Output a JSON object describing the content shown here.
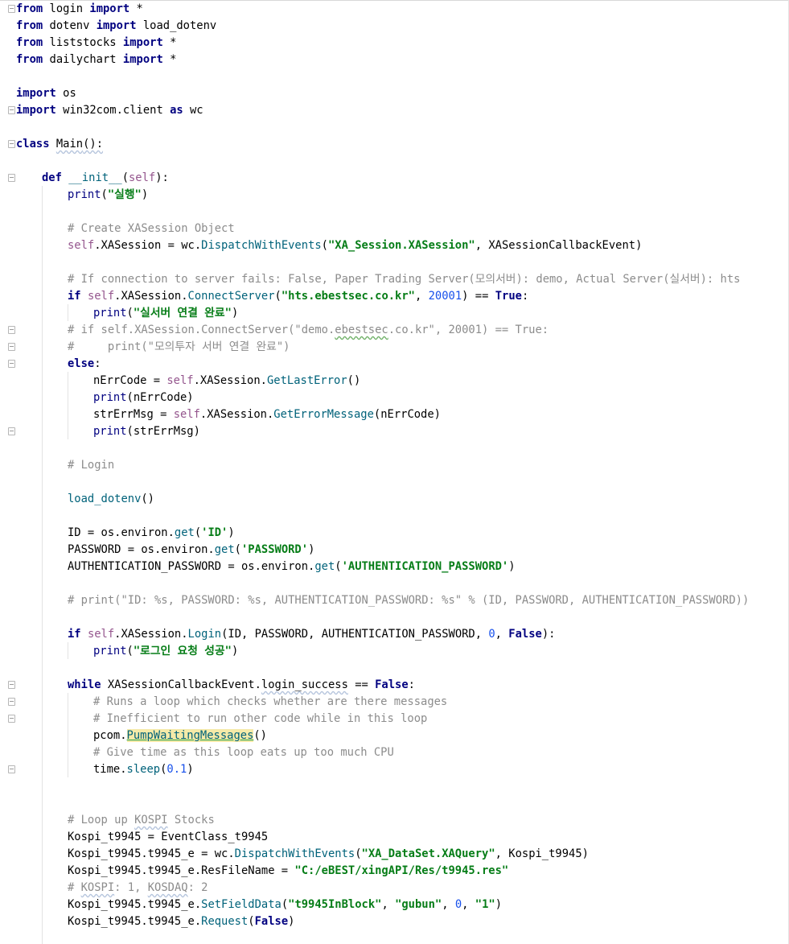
{
  "editor": {
    "lines": [
      {
        "row": 0,
        "indent": 0,
        "tokens": [
          {
            "t": "from",
            "c": "kw"
          },
          {
            "t": " login "
          },
          {
            "t": "import",
            "c": "kw"
          },
          {
            "t": " *"
          }
        ]
      },
      {
        "row": 1,
        "indent": 0,
        "tokens": [
          {
            "t": "from",
            "c": "kw"
          },
          {
            "t": " dotenv "
          },
          {
            "t": "import",
            "c": "kw"
          },
          {
            "t": " load_dotenv"
          }
        ]
      },
      {
        "row": 2,
        "indent": 0,
        "tokens": [
          {
            "t": "from",
            "c": "kw"
          },
          {
            "t": " liststocks "
          },
          {
            "t": "import",
            "c": "kw"
          },
          {
            "t": " *"
          }
        ]
      },
      {
        "row": 3,
        "indent": 0,
        "tokens": [
          {
            "t": "from",
            "c": "kw"
          },
          {
            "t": " dailychart "
          },
          {
            "t": "import",
            "c": "kw"
          },
          {
            "t": " *"
          }
        ]
      },
      {
        "row": 5,
        "indent": 0,
        "tokens": [
          {
            "t": "import",
            "c": "kw"
          },
          {
            "t": " os"
          }
        ]
      },
      {
        "row": 6,
        "indent": 0,
        "tokens": [
          {
            "t": "import",
            "c": "kw"
          },
          {
            "t": " win32com.client "
          },
          {
            "t": "as",
            "c": "kw"
          },
          {
            "t": " wc"
          }
        ]
      },
      {
        "row": 8,
        "indent": 0,
        "tokens": [
          {
            "t": "class",
            "c": "kw"
          },
          {
            "t": " "
          },
          {
            "t": "Main",
            "c": "ul"
          },
          {
            "t": "():",
            "c": "ul"
          }
        ]
      },
      {
        "row": 10,
        "indent": 1,
        "tokens": [
          {
            "t": "def",
            "c": "kw"
          },
          {
            "t": " "
          },
          {
            "t": "__init__",
            "c": "fn"
          },
          {
            "t": "("
          },
          {
            "t": "self",
            "c": "self"
          },
          {
            "t": "):"
          }
        ]
      },
      {
        "row": 11,
        "indent": 2,
        "tokens": [
          {
            "t": "print",
            "c": "builtin"
          },
          {
            "t": "("
          },
          {
            "t": "\"실행\"",
            "c": "str"
          },
          {
            "t": ")"
          }
        ]
      },
      {
        "row": 13,
        "indent": 2,
        "tokens": [
          {
            "t": "# Create XASession Object",
            "c": "cmt"
          }
        ]
      },
      {
        "row": 14,
        "indent": 2,
        "tokens": [
          {
            "t": "self",
            "c": "self"
          },
          {
            "t": ".XASession = wc."
          },
          {
            "t": "DispatchWithEvents",
            "c": "fn"
          },
          {
            "t": "("
          },
          {
            "t": "\"XA_Session.XASession\"",
            "c": "str"
          },
          {
            "t": ", XASessionCallbackEvent)"
          }
        ]
      },
      {
        "row": 16,
        "indent": 2,
        "tokens": [
          {
            "t": "# If connection to server fails: False, Paper Trading Server(모의서버): demo, Actual Server(실서버): hts",
            "c": "cmt"
          }
        ]
      },
      {
        "row": 17,
        "indent": 2,
        "tokens": [
          {
            "t": "if",
            "c": "kw"
          },
          {
            "t": " "
          },
          {
            "t": "self",
            "c": "self"
          },
          {
            "t": ".XASession."
          },
          {
            "t": "ConnectServer",
            "c": "fn"
          },
          {
            "t": "("
          },
          {
            "t": "\"hts.ebestsec.co.kr\"",
            "c": "str"
          },
          {
            "t": ", "
          },
          {
            "t": "20001",
            "c": "num"
          },
          {
            "t": ") == "
          },
          {
            "t": "True",
            "c": "kw"
          },
          {
            "t": ":"
          }
        ]
      },
      {
        "row": 18,
        "indent": 3,
        "tokens": [
          {
            "t": "print",
            "c": "builtin"
          },
          {
            "t": "("
          },
          {
            "t": "\"실서버 연결 완료\"",
            "c": "str"
          },
          {
            "t": ")"
          }
        ]
      },
      {
        "row": 19,
        "indent": 2,
        "tokens": [
          {
            "t": "# if self.XASession.ConnectServer(\"demo.",
            "c": "cmt"
          },
          {
            "t": "ebestsec",
            "c": "cmt green-ul"
          },
          {
            "t": ".co.kr\", 20001) == True:",
            "c": "cmt"
          }
        ]
      },
      {
        "row": 20,
        "indent": 2,
        "tokens": [
          {
            "t": "#     print(\"모의투자 서버 연결 완료\")",
            "c": "cmt"
          }
        ]
      },
      {
        "row": 21,
        "indent": 2,
        "tokens": [
          {
            "t": "else",
            "c": "kw"
          },
          {
            "t": ":"
          }
        ]
      },
      {
        "row": 22,
        "indent": 3,
        "tokens": [
          {
            "t": "nErrCode = "
          },
          {
            "t": "self",
            "c": "self"
          },
          {
            "t": ".XASession."
          },
          {
            "t": "GetLastError",
            "c": "fn"
          },
          {
            "t": "()"
          }
        ]
      },
      {
        "row": 23,
        "indent": 3,
        "tokens": [
          {
            "t": "print",
            "c": "builtin"
          },
          {
            "t": "(nErrCode)"
          }
        ]
      },
      {
        "row": 24,
        "indent": 3,
        "tokens": [
          {
            "t": "strErrMsg = "
          },
          {
            "t": "self",
            "c": "self"
          },
          {
            "t": ".XASession."
          },
          {
            "t": "GetErrorMessage",
            "c": "fn"
          },
          {
            "t": "(nErrCode)"
          }
        ]
      },
      {
        "row": 25,
        "indent": 3,
        "tokens": [
          {
            "t": "print",
            "c": "builtin"
          },
          {
            "t": "(strErrMsg)"
          }
        ]
      },
      {
        "row": 27,
        "indent": 2,
        "tokens": [
          {
            "t": "# Login",
            "c": "cmt"
          }
        ]
      },
      {
        "row": 29,
        "indent": 2,
        "tokens": [
          {
            "t": "load_dotenv",
            "c": "fn"
          },
          {
            "t": "()"
          }
        ]
      },
      {
        "row": 31,
        "indent": 2,
        "tokens": [
          {
            "t": "ID = os.environ."
          },
          {
            "t": "get",
            "c": "fn"
          },
          {
            "t": "("
          },
          {
            "t": "'ID'",
            "c": "str"
          },
          {
            "t": ")"
          }
        ]
      },
      {
        "row": 32,
        "indent": 2,
        "tokens": [
          {
            "t": "PASSWORD = os.environ."
          },
          {
            "t": "get",
            "c": "fn"
          },
          {
            "t": "("
          },
          {
            "t": "'PASSWORD'",
            "c": "str"
          },
          {
            "t": ")"
          }
        ]
      },
      {
        "row": 33,
        "indent": 2,
        "tokens": [
          {
            "t": "AUTHENTICATION_PASSWORD = os.environ."
          },
          {
            "t": "get",
            "c": "fn"
          },
          {
            "t": "("
          },
          {
            "t": "'AUTHENTICATION_PASSWORD'",
            "c": "str"
          },
          {
            "t": ")"
          }
        ]
      },
      {
        "row": 35,
        "indent": 2,
        "tokens": [
          {
            "t": "# print(\"ID: %s, PASSWORD: %s, AUTHENTICATION_PASSWORD: %s\" % (ID, PASSWORD, AUTHENTICATION_PASSWORD))",
            "c": "cmt"
          }
        ]
      },
      {
        "row": 37,
        "indent": 2,
        "tokens": [
          {
            "t": "if",
            "c": "kw"
          },
          {
            "t": " "
          },
          {
            "t": "self",
            "c": "self"
          },
          {
            "t": ".XASession."
          },
          {
            "t": "Login",
            "c": "fn"
          },
          {
            "t": "(ID, PASSWORD, AUTHENTICATION_PASSWORD, "
          },
          {
            "t": "0",
            "c": "num"
          },
          {
            "t": ", "
          },
          {
            "t": "False",
            "c": "kw"
          },
          {
            "t": "):"
          }
        ]
      },
      {
        "row": 38,
        "indent": 3,
        "tokens": [
          {
            "t": "print",
            "c": "builtin"
          },
          {
            "t": "("
          },
          {
            "t": "\"로그인 요청 성공\"",
            "c": "str"
          },
          {
            "t": ")"
          }
        ]
      },
      {
        "row": 40,
        "indent": 2,
        "tokens": [
          {
            "t": "while",
            "c": "kw"
          },
          {
            "t": " XASessionCallbackEvent."
          },
          {
            "t": "login_success",
            "c": "ul"
          },
          {
            "t": " == "
          },
          {
            "t": "False",
            "c": "kw"
          },
          {
            "t": ":"
          }
        ]
      },
      {
        "row": 41,
        "indent": 3,
        "tokens": [
          {
            "t": "# Runs a loop which checks whether are there messages",
            "c": "cmt"
          }
        ]
      },
      {
        "row": 42,
        "indent": 3,
        "tokens": [
          {
            "t": "# Inefficient to run other code while in this loop",
            "c": "cmt"
          }
        ]
      },
      {
        "row": 43,
        "indent": 3,
        "tokens": [
          {
            "t": "pcom."
          },
          {
            "t": "PumpWaitingMessages",
            "c": "fn hl"
          },
          {
            "t": "()"
          }
        ]
      },
      {
        "row": 44,
        "indent": 3,
        "tokens": [
          {
            "t": "# Give time as this loop eats up too much CPU",
            "c": "cmt"
          }
        ]
      },
      {
        "row": 45,
        "indent": 3,
        "tokens": [
          {
            "t": "time."
          },
          {
            "t": "sleep",
            "c": "fn"
          },
          {
            "t": "("
          },
          {
            "t": "0.1",
            "c": "num"
          },
          {
            "t": ")"
          }
        ]
      },
      {
        "row": 48,
        "indent": 2,
        "tokens": [
          {
            "t": "# Loop up ",
            "c": "cmt"
          },
          {
            "t": "KOSPI",
            "c": "cmt ul"
          },
          {
            "t": " Stocks",
            "c": "cmt"
          }
        ]
      },
      {
        "row": 49,
        "indent": 2,
        "tokens": [
          {
            "t": "Kospi_t9945 = EventClass_t9945"
          }
        ]
      },
      {
        "row": 50,
        "indent": 2,
        "tokens": [
          {
            "t": "Kospi_t9945.t9945_e = wc."
          },
          {
            "t": "DispatchWithEvents",
            "c": "fn"
          },
          {
            "t": "("
          },
          {
            "t": "\"XA_DataSet.XAQuery\"",
            "c": "str"
          },
          {
            "t": ", Kospi_t9945)"
          }
        ]
      },
      {
        "row": 51,
        "indent": 2,
        "tokens": [
          {
            "t": "Kospi_t9945.t9945_e.ResFileName = "
          },
          {
            "t": "\"C:/eBEST/xingAPI/Res/t9945.res\"",
            "c": "str"
          }
        ]
      },
      {
        "row": 52,
        "indent": 2,
        "tokens": [
          {
            "t": "# ",
            "c": "cmt"
          },
          {
            "t": "KOSPI",
            "c": "cmt ul"
          },
          {
            "t": ": 1, ",
            "c": "cmt"
          },
          {
            "t": "KOSDAQ",
            "c": "cmt ul"
          },
          {
            "t": ": 2",
            "c": "cmt"
          }
        ]
      },
      {
        "row": 53,
        "indent": 2,
        "tokens": [
          {
            "t": "Kospi_t9945.t9945_e."
          },
          {
            "t": "SetFieldData",
            "c": "fn"
          },
          {
            "t": "("
          },
          {
            "t": "\"t9945InBlock\"",
            "c": "str"
          },
          {
            "t": ", "
          },
          {
            "t": "\"gubun\"",
            "c": "str"
          },
          {
            "t": ", "
          },
          {
            "t": "0",
            "c": "num"
          },
          {
            "t": ", "
          },
          {
            "t": "\"1\"",
            "c": "str"
          },
          {
            "t": ")"
          }
        ]
      },
      {
        "row": 54,
        "indent": 2,
        "tokens": [
          {
            "t": "Kospi_t9945.t9945_e."
          },
          {
            "t": "Request",
            "c": "fn"
          },
          {
            "t": "("
          },
          {
            "t": "False",
            "c": "kw"
          },
          {
            "t": ")"
          }
        ]
      }
    ]
  }
}
